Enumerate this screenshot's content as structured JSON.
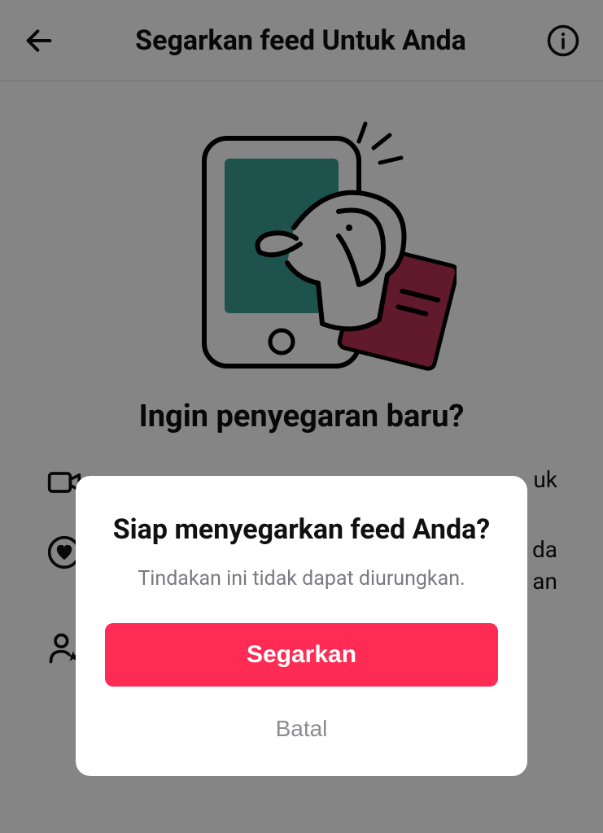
{
  "header": {
    "title": "Segarkan feed Untuk Anda"
  },
  "page": {
    "subhead": "Ingin penyegaran baru?",
    "features": [
      {
        "text": "uk"
      },
      {
        "text": "da\nan"
      },
      {
        "text": ""
      }
    ]
  },
  "dialog": {
    "title": "Siap menyegarkan feed Anda?",
    "subtitle": "Tindakan ini tidak dapat diurungkan.",
    "primary_label": "Segarkan",
    "cancel_label": "Batal"
  }
}
